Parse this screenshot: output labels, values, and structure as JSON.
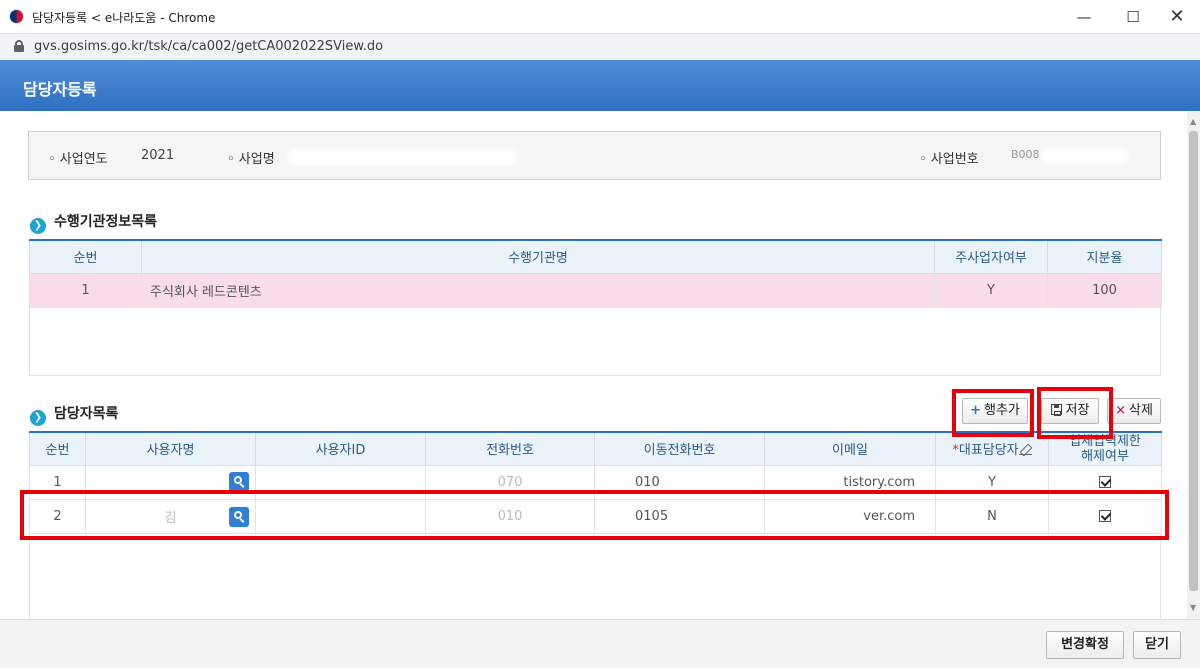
{
  "window": {
    "title": "담당자등록 < e나라도움 - Chrome",
    "minimize": "—",
    "maximize": "☐",
    "close": "✕"
  },
  "address_bar": {
    "url": "gvs.gosims.go.kr/tsk/ca/ca002/getCA002022SView.do"
  },
  "page": {
    "title": "담당자등록"
  },
  "info": {
    "year_label": "◦ 사업연도",
    "year_value": "2021",
    "project_label": "◦ 사업명",
    "project_number_label": "◦ 사업번호",
    "project_number_value": "B008"
  },
  "org_section": {
    "title": "수행기관정보목록",
    "columns": [
      "순번",
      "수행기관명",
      "주사업자여부",
      "지분율"
    ],
    "rows": [
      {
        "no": "1",
        "name": "주식회사 레드콘텐츠",
        "primary": "Y",
        "share": "100"
      }
    ]
  },
  "contact_section": {
    "title": "담당자목록",
    "columns": [
      "순번",
      "사용자명",
      "사용자ID",
      "전화번호",
      "이동전화번호",
      "이메일",
      "대표담당자",
      "업체입력제한\n해제여부"
    ],
    "required_mark": "*",
    "header_col8_line1": "업체입력제한",
    "header_col8_line2": "해제여부",
    "rows": [
      {
        "no": "1",
        "name": "",
        "id": "",
        "phone": "070",
        "mobile": "010",
        "email": "tistory.com",
        "rep": "Y"
      },
      {
        "no": "2",
        "name": "김",
        "id": "",
        "phone": "010",
        "mobile": "0105",
        "email": "ver.com",
        "rep": "N"
      }
    ]
  },
  "toolbar": {
    "add_row": "행추가",
    "save": "저장",
    "delete": "삭제"
  },
  "footer": {
    "confirm": "변경확정",
    "close": "닫기"
  }
}
